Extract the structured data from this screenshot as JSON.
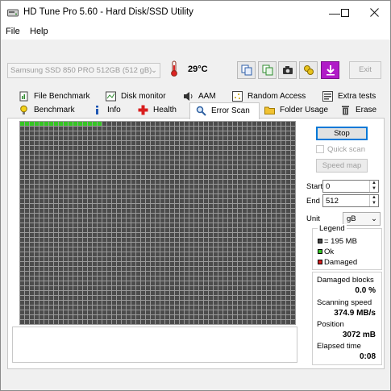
{
  "window": {
    "title": "HD Tune Pro 5.60 - Hard Disk/SSD Utility"
  },
  "menu": {
    "file": "File",
    "help": "Help"
  },
  "toolbar": {
    "drive": "Samsung SSD 850 PRO 512GB (512 gB)",
    "temperature": "29°C",
    "exit_label": "Exit"
  },
  "tabs": {
    "row1": [
      "File Benchmark",
      "Disk monitor",
      "AAM",
      "Random Access",
      "Extra tests"
    ],
    "row2": [
      "Benchmark",
      "Info",
      "Health",
      "Error Scan",
      "Folder Usage",
      "Erase"
    ],
    "active": "Error Scan"
  },
  "scan": {
    "ok_blocks_in_first_row": 17,
    "controls": {
      "stop_label": "Stop",
      "quick_scan_label": "Quick scan",
      "speed_map_label": "Speed map",
      "start_label": "Start",
      "start_value": "0",
      "end_label": "End",
      "end_value": "512",
      "unit_label": "Unit",
      "unit_value": "gB"
    },
    "legend": {
      "title": "Legend",
      "block_size": "= 195 MB",
      "ok": "Ok",
      "damaged": "Damaged"
    },
    "stats": {
      "damaged_blocks_label": "Damaged blocks",
      "damaged_blocks_value": "0.0 %",
      "scanning_speed_label": "Scanning speed",
      "scanning_speed_value": "374.9 MB/s",
      "position_label": "Position",
      "position_value": "3072 mB",
      "elapsed_label": "Elapsed time",
      "elapsed_value": "0:08"
    }
  },
  "colors": {
    "ok": "#35c624",
    "damaged": "#d81e1e",
    "block": "#4c4c4c",
    "accent": "#0078d7"
  }
}
